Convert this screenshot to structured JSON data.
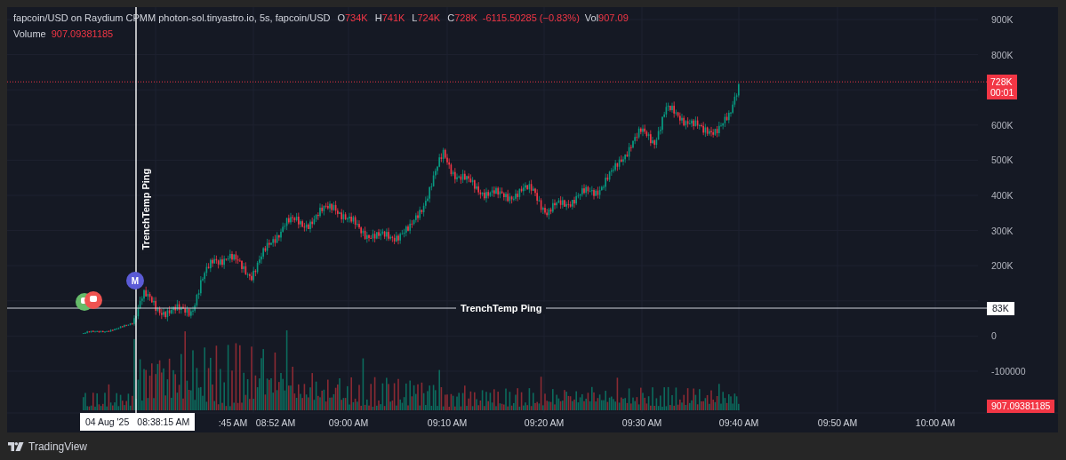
{
  "legend": {
    "symbol_line": "fapcoin/USD on Raydium CPMM photon-sol.tinyastro.io, 5s, fapcoin/USD",
    "ohlc": [
      {
        "label": "O",
        "value": "734K"
      },
      {
        "label": "H",
        "value": "741K"
      },
      {
        "label": "L",
        "value": "724K"
      },
      {
        "label": "C",
        "value": "728K"
      }
    ],
    "change": "-6115.50285 (−0.83%)",
    "vol_label": "Vol",
    "vol_value": "907.09"
  },
  "volume_legend": {
    "label": "Volume",
    "value": "907.09381185"
  },
  "price_axis": {
    "ticks": [
      "900K",
      "800K",
      "600K",
      "500K",
      "400K",
      "300K",
      "200K",
      "0",
      "-100000"
    ]
  },
  "time_axis": {
    "labels": [
      ":45 AM",
      "08:52 AM",
      "09:00 AM",
      "09:10 AM",
      "09:20 AM",
      "09:30 AM",
      "09:40 AM",
      "09:50 AM",
      "10:00 AM"
    ]
  },
  "current_price": {
    "value": "728K",
    "countdown": "00:01"
  },
  "volume_price": "907.09381185",
  "crosshair": {
    "price": "83K",
    "date": "04 Aug '25",
    "time": "08:38:15 AM"
  },
  "horizontal_line": {
    "label": "TrenchTemp Ping"
  },
  "vertical_line": {
    "label": "TrenchTemp Ping"
  },
  "markers": [
    {
      "kind": "icon",
      "color": "#66bb6a"
    },
    {
      "kind": "icon",
      "color": "#ef5350"
    },
    {
      "kind": "letter",
      "text": "M",
      "color": "#5b5bd6"
    }
  ],
  "footer": {
    "brand": "TradingView"
  }
}
